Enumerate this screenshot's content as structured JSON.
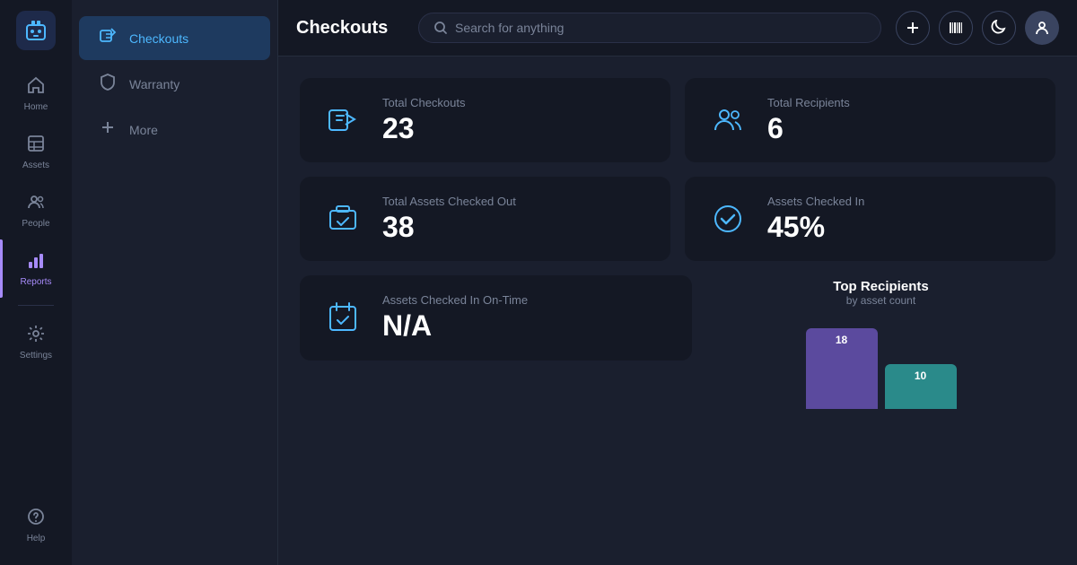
{
  "app": {
    "logo_icon": "🤖",
    "title": "Checkouts"
  },
  "search": {
    "placeholder": "Search for anything"
  },
  "nav": {
    "items": [
      {
        "id": "home",
        "label": "Home",
        "icon": "⌂",
        "active": false
      },
      {
        "id": "assets",
        "label": "Assets",
        "icon": "⊟",
        "active": false
      },
      {
        "id": "people",
        "label": "People",
        "icon": "👥",
        "active": false
      },
      {
        "id": "reports",
        "label": "Reports",
        "icon": "📊",
        "active": true
      },
      {
        "id": "settings",
        "label": "Settings",
        "icon": "⚙",
        "active": false
      },
      {
        "id": "help",
        "label": "Help",
        "icon": "?",
        "active": false
      }
    ]
  },
  "secondary_nav": {
    "items": [
      {
        "id": "checkouts",
        "label": "Checkouts",
        "icon": "checkouts",
        "active": true
      },
      {
        "id": "warranty",
        "label": "Warranty",
        "icon": "shield",
        "active": false
      },
      {
        "id": "more",
        "label": "More",
        "icon": "plus",
        "active": false
      }
    ]
  },
  "stats": {
    "total_checkouts": {
      "label": "Total Checkouts",
      "value": "23"
    },
    "total_recipients": {
      "label": "Total Recipients",
      "value": "6"
    },
    "total_assets_checked_out": {
      "label": "Total Assets Checked Out",
      "value": "38"
    },
    "assets_checked_in": {
      "label": "Assets Checked In",
      "value": "45%"
    },
    "assets_checked_in_ontime": {
      "label": "Assets Checked In On-Time",
      "value": "N/A"
    }
  },
  "chart": {
    "title": "Top Recipients",
    "subtitle": "by asset count",
    "bars": [
      {
        "value": 18,
        "color": "#5b4a9e",
        "height": 90
      },
      {
        "value": 10,
        "color": "#2a8a8a",
        "height": 50
      }
    ]
  },
  "header_buttons": {
    "add": "+",
    "barcode": "▦",
    "moon": "☽"
  }
}
